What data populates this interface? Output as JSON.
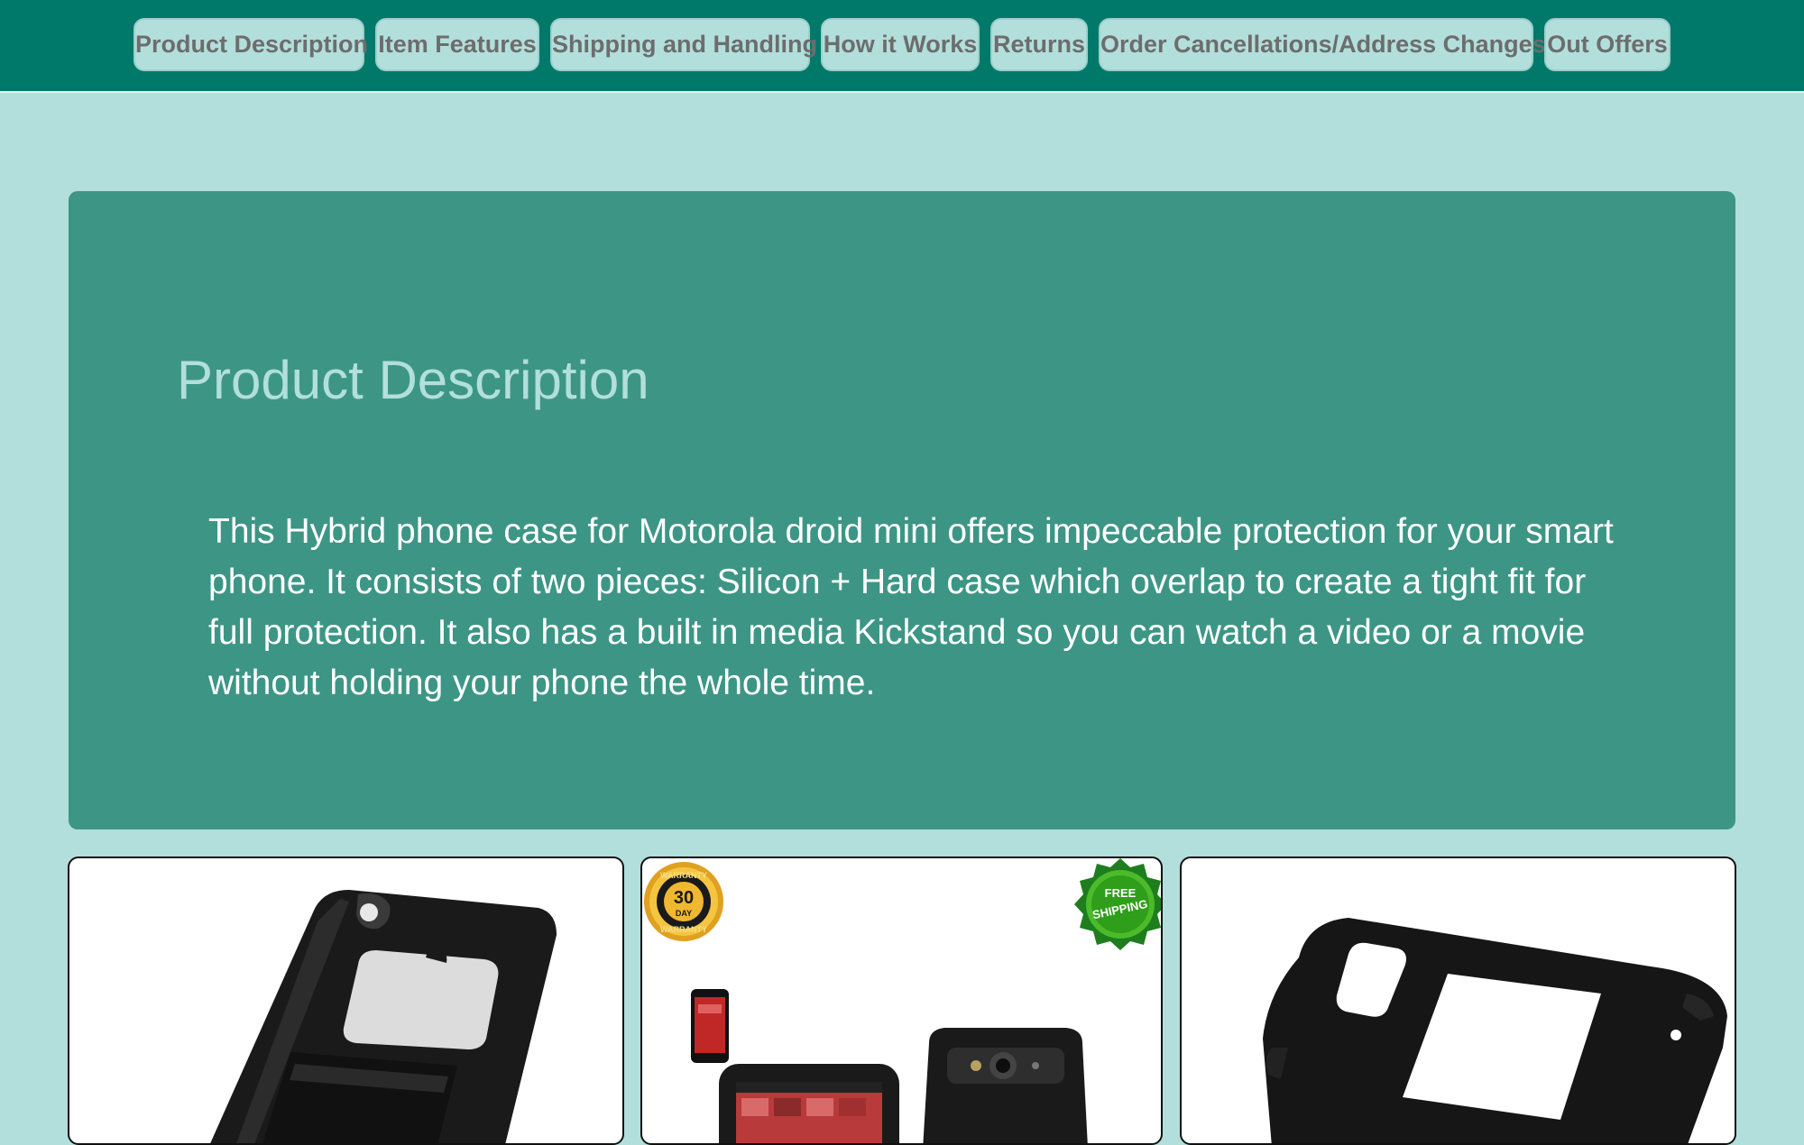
{
  "nav": {
    "items": [
      {
        "label": "Product Description"
      },
      {
        "label": "Item Features"
      },
      {
        "label": "Shipping and Handling"
      },
      {
        "label": "How it Works"
      },
      {
        "label": "Returns"
      },
      {
        "label": "Order Cancellations/Address Changes"
      },
      {
        "label": "Out Offers"
      }
    ]
  },
  "description": {
    "title": "Product Description",
    "body": "This Hybrid phone case for Motorola droid mini offers impeccable protection for your smart phone. It consists of two pieces: Silicon + Hard case which overlap to create a tight fit for full protection. It also has a built in media Kickstand so you can watch a video or a movie without holding your phone the whole time."
  },
  "gallery": {
    "images": [
      {
        "alt": "phone-case-kickstand-view"
      },
      {
        "alt": "phone-case-product-collage"
      },
      {
        "alt": "silicone-skin-view"
      }
    ],
    "warranty_badge": {
      "line1": "WARRANTY",
      "big": "30",
      "small": "DAY",
      "line2": "WARRANTY"
    },
    "shipping_badge": {
      "line1": "FREE",
      "line2": "SHIPPING"
    }
  },
  "colors": {
    "nav_bg": "#00796b",
    "page_bg": "#b2dfdb",
    "panel_bg": "#3d9685",
    "title_color": "#b2dfdb",
    "body_color": "#ffffff"
  }
}
